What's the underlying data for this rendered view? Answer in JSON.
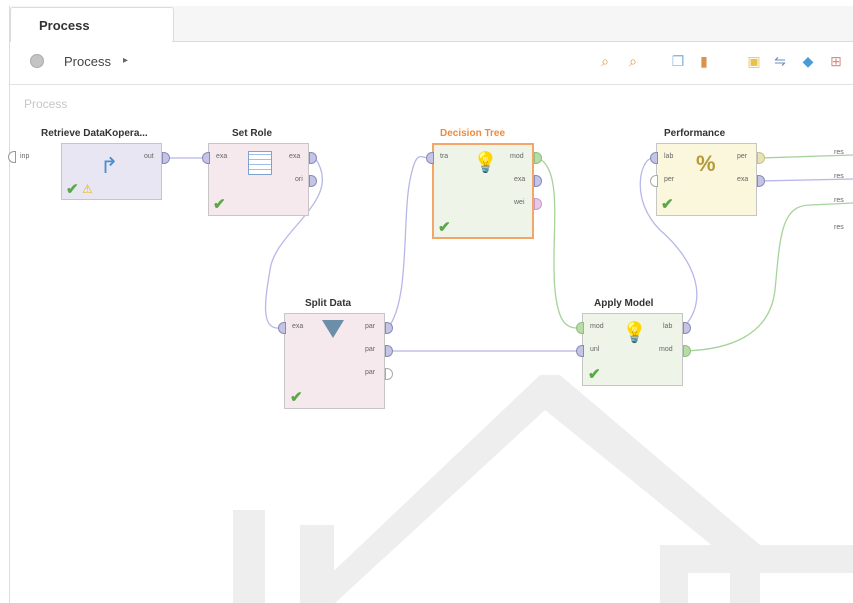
{
  "tab": {
    "label": "Process"
  },
  "breadcrumb": {
    "label": "Process",
    "arrow": "▸"
  },
  "toolbar_icons": [
    "zoom-in-icon",
    "zoom-out-icon",
    "copy-icon",
    "paste-icon",
    "add-note-icon",
    "auto-wire-icon",
    "eraser-icon",
    "grid-icon"
  ],
  "canvas": {
    "label": "Process",
    "inp_port": "inp"
  },
  "operators": {
    "retrieve": {
      "title": "Retrieve DataKopera...",
      "ports": {
        "out": "out"
      }
    },
    "set_role": {
      "title": "Set Role",
      "ports": {
        "exa_in": "exa",
        "exa_out": "exa",
        "ori": "ori"
      }
    },
    "decision_tree": {
      "title": "Decision Tree",
      "ports": {
        "tra": "tra",
        "mod": "mod",
        "exa": "exa",
        "wei": "wei"
      }
    },
    "performance": {
      "title": "Performance",
      "ports": {
        "lab": "lab",
        "per_in": "per",
        "per_out": "per",
        "exa": "exa"
      }
    },
    "split_data": {
      "title": "Split Data",
      "ports": {
        "exa": "exa",
        "par1": "par",
        "par2": "par",
        "par3": "par"
      }
    },
    "apply_model": {
      "title": "Apply Model",
      "ports": {
        "mod_in": "mod",
        "unl": "unl",
        "lab": "lab",
        "mod_out": "mod"
      }
    }
  },
  "result_ports": [
    "res",
    "res",
    "res",
    "res"
  ],
  "colors": {
    "highlight": "#f08a3c",
    "check": "#5aa84a",
    "wire_purple": "#b7b7e8",
    "wire_green": "#a7d39a"
  }
}
